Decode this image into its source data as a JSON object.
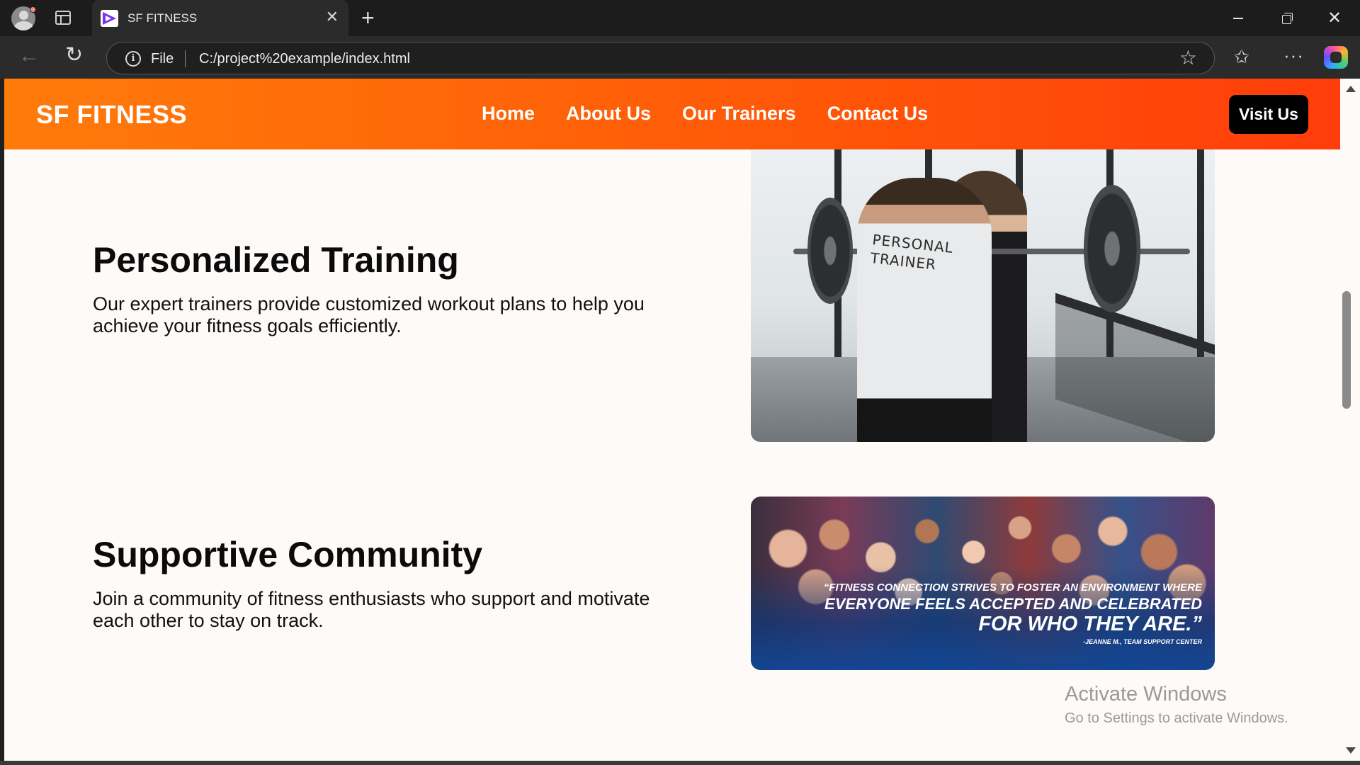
{
  "browser": {
    "tab_title": "SF FITNESS",
    "address_prefix": "File",
    "url": "C:/project%20example/index.html",
    "icons": [
      "profile-icon",
      "tab-actions-icon",
      "favicon-icon",
      "close-icon",
      "plus-icon",
      "minimize-icon",
      "restore-icon",
      "window-close-icon",
      "back-icon",
      "reload-icon",
      "info-icon",
      "star-icon",
      "favorites-icon",
      "more-icon",
      "copilot-icon"
    ],
    "tab_close_glyph": "✕",
    "new_tab_glyph": "+",
    "window_close_glyph": "✕",
    "back_glyph": "←",
    "reload_glyph": "↻",
    "info_glyph": "i",
    "star_glyph": "☆",
    "favorites_glyph": "✩",
    "more_glyph": "···"
  },
  "site": {
    "logo": "SF FITNESS",
    "nav": [
      "Home",
      "About Us",
      "Our Trainers",
      "Contact Us"
    ],
    "cta": "Visit Us",
    "colors": {
      "header_start": "#ff7b0a",
      "header_end": "#ff3d0a",
      "cta_bg": "#000000",
      "page_bg": "#fdfaf8"
    }
  },
  "features": [
    {
      "title": "Personalized Training",
      "text": "Our expert trainers provide customized workout plans to help you achieve your fitness goals efficiently.",
      "image_text": [
        "PERSONAL",
        "TRAINER"
      ]
    },
    {
      "title": "Supportive Community",
      "text": "Join a community of fitness enthusiasts who support and motivate each other to stay on track.",
      "image_text": [
        "“FITNESS CONNECTION STRIVES TO FOSTER AN ENVIRONMENT WHERE",
        "EVERYONE FEELS ACCEPTED AND CELEBRATED",
        "FOR WHO THEY ARE.”",
        "-JEANNE M., TEAM SUPPORT CENTER"
      ]
    }
  ],
  "os_watermark": {
    "title": "Activate Windows",
    "subtitle": "Go to Settings to activate Windows."
  }
}
